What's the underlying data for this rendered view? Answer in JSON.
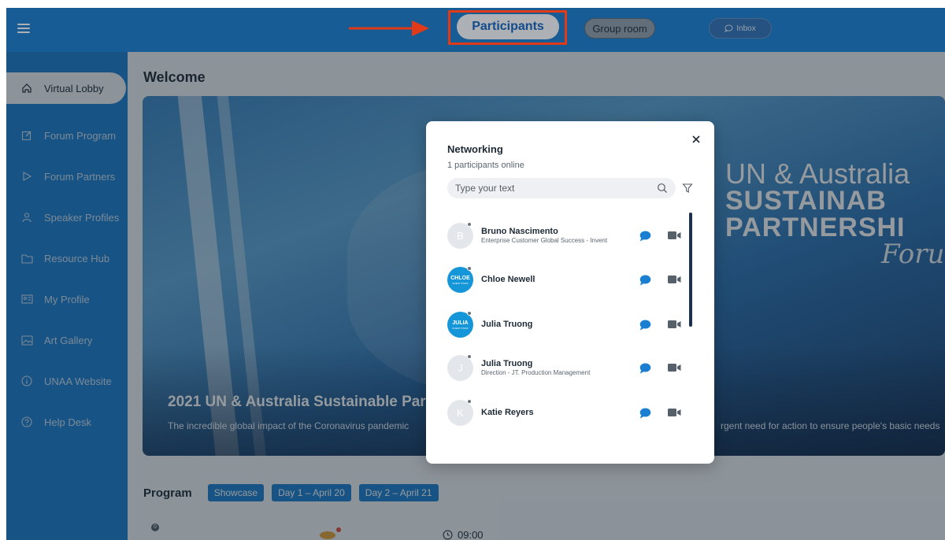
{
  "topbar": {
    "tabs": [
      {
        "label": "Participants",
        "active": true
      },
      {
        "label": "Group room",
        "active": false
      },
      {
        "label": "Inbox",
        "active": false
      }
    ]
  },
  "sidebar": {
    "items": [
      {
        "label": "Virtual Lobby",
        "icon": "home-icon",
        "active": true
      },
      {
        "label": "Forum Program",
        "icon": "edit-icon"
      },
      {
        "label": "Forum Partners",
        "icon": "play-icon"
      },
      {
        "label": "Speaker Profiles",
        "icon": "person-icon"
      },
      {
        "label": "Resource Hub",
        "icon": "folder-icon"
      },
      {
        "label": "My Profile",
        "icon": "id-card-icon"
      },
      {
        "label": "Art Gallery",
        "icon": "image-icon"
      },
      {
        "label": "UNAA Website",
        "icon": "info-icon"
      },
      {
        "label": "Help Desk",
        "icon": "help-icon"
      }
    ]
  },
  "main": {
    "title": "Welcome",
    "hero": {
      "right_line1": "UN & Australia",
      "right_line2": "SUSTAINAB",
      "right_line3": "PARTNERSHI",
      "right_line4": "Foru",
      "title": "2021 UN & Australia Sustainable Par",
      "desc_left": "The incredible global impact of the Coronavirus pandemic",
      "desc_right": "rgent need for action to ensure people's basic needs"
    },
    "program": {
      "label": "Program",
      "tags": [
        "Showcase",
        "Day 1 – April 20",
        "Day 2 – April 21"
      ],
      "count": "0",
      "time": "09:00"
    }
  },
  "modal": {
    "title": "Networking",
    "subtitle": "1 participants online",
    "search_placeholder": "Type your text",
    "participants": [
      {
        "initial": "B",
        "name": "Bruno Nascimento",
        "role": "Enterprise Customer Global Success - Invent"
      },
      {
        "initial": "CHLOE",
        "badge": "GUEST STAFF",
        "name": "Chloe Newell",
        "role": ""
      },
      {
        "initial": "JULIA",
        "badge": "GUEST STAFF",
        "name": "Julia Truong",
        "role": ""
      },
      {
        "initial": "J",
        "name": "Julia Truong",
        "role": "Direction - JT. Production Management"
      },
      {
        "initial": "K",
        "name": "Katie Reyers",
        "role": ""
      }
    ]
  },
  "colors": {
    "brand": "#1a7fd0",
    "annotation": "#e13a18",
    "chat": "#1a7fd0"
  }
}
